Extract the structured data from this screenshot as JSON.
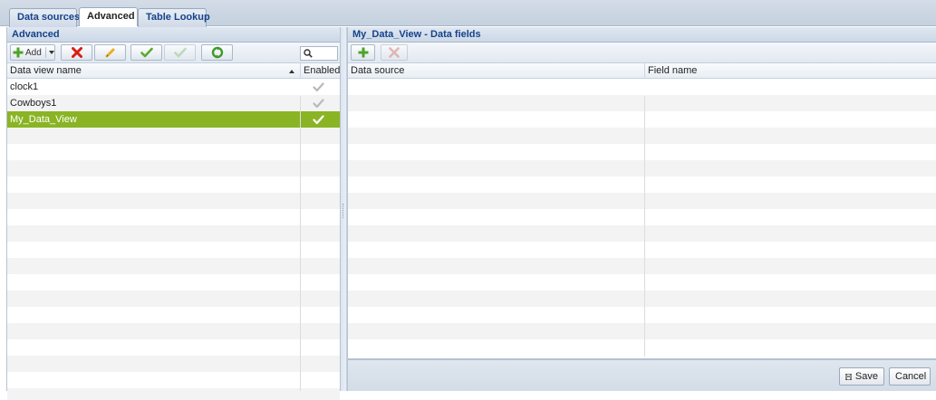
{
  "tabs": [
    {
      "label": "Data sources"
    },
    {
      "label": "Advanced"
    },
    {
      "label": "Table Lookup"
    }
  ],
  "left_panel": {
    "title": "Advanced",
    "toolbar": {
      "add_label": "Add",
      "buttons": [
        "add-button",
        "delete-icon",
        "edit-icon",
        "enable-check-icon",
        "disable-check-icon",
        "refresh-icon"
      ],
      "search_icon": "search-icon"
    },
    "columns": [
      "Data view name",
      "Enabled"
    ],
    "rows": [
      {
        "name": "clock1",
        "enabled": true,
        "selected": false
      },
      {
        "name": "Cowboys1",
        "enabled": true,
        "selected": false
      },
      {
        "name": "My_Data_View",
        "enabled": true,
        "selected": true
      }
    ]
  },
  "right_panel": {
    "title": "My_Data_View - Data fields",
    "toolbar": {
      "buttons": [
        "add-field-icon",
        "remove-field-icon"
      ]
    },
    "columns": [
      "Data source",
      "Field name"
    ],
    "save_label": "Save",
    "cancel_label": "Cancel"
  },
  "colors": {
    "selected_row": "#8ab424",
    "header_text": "#15428b",
    "add_green": "#4fa328",
    "delete_red": "#d81e12"
  }
}
